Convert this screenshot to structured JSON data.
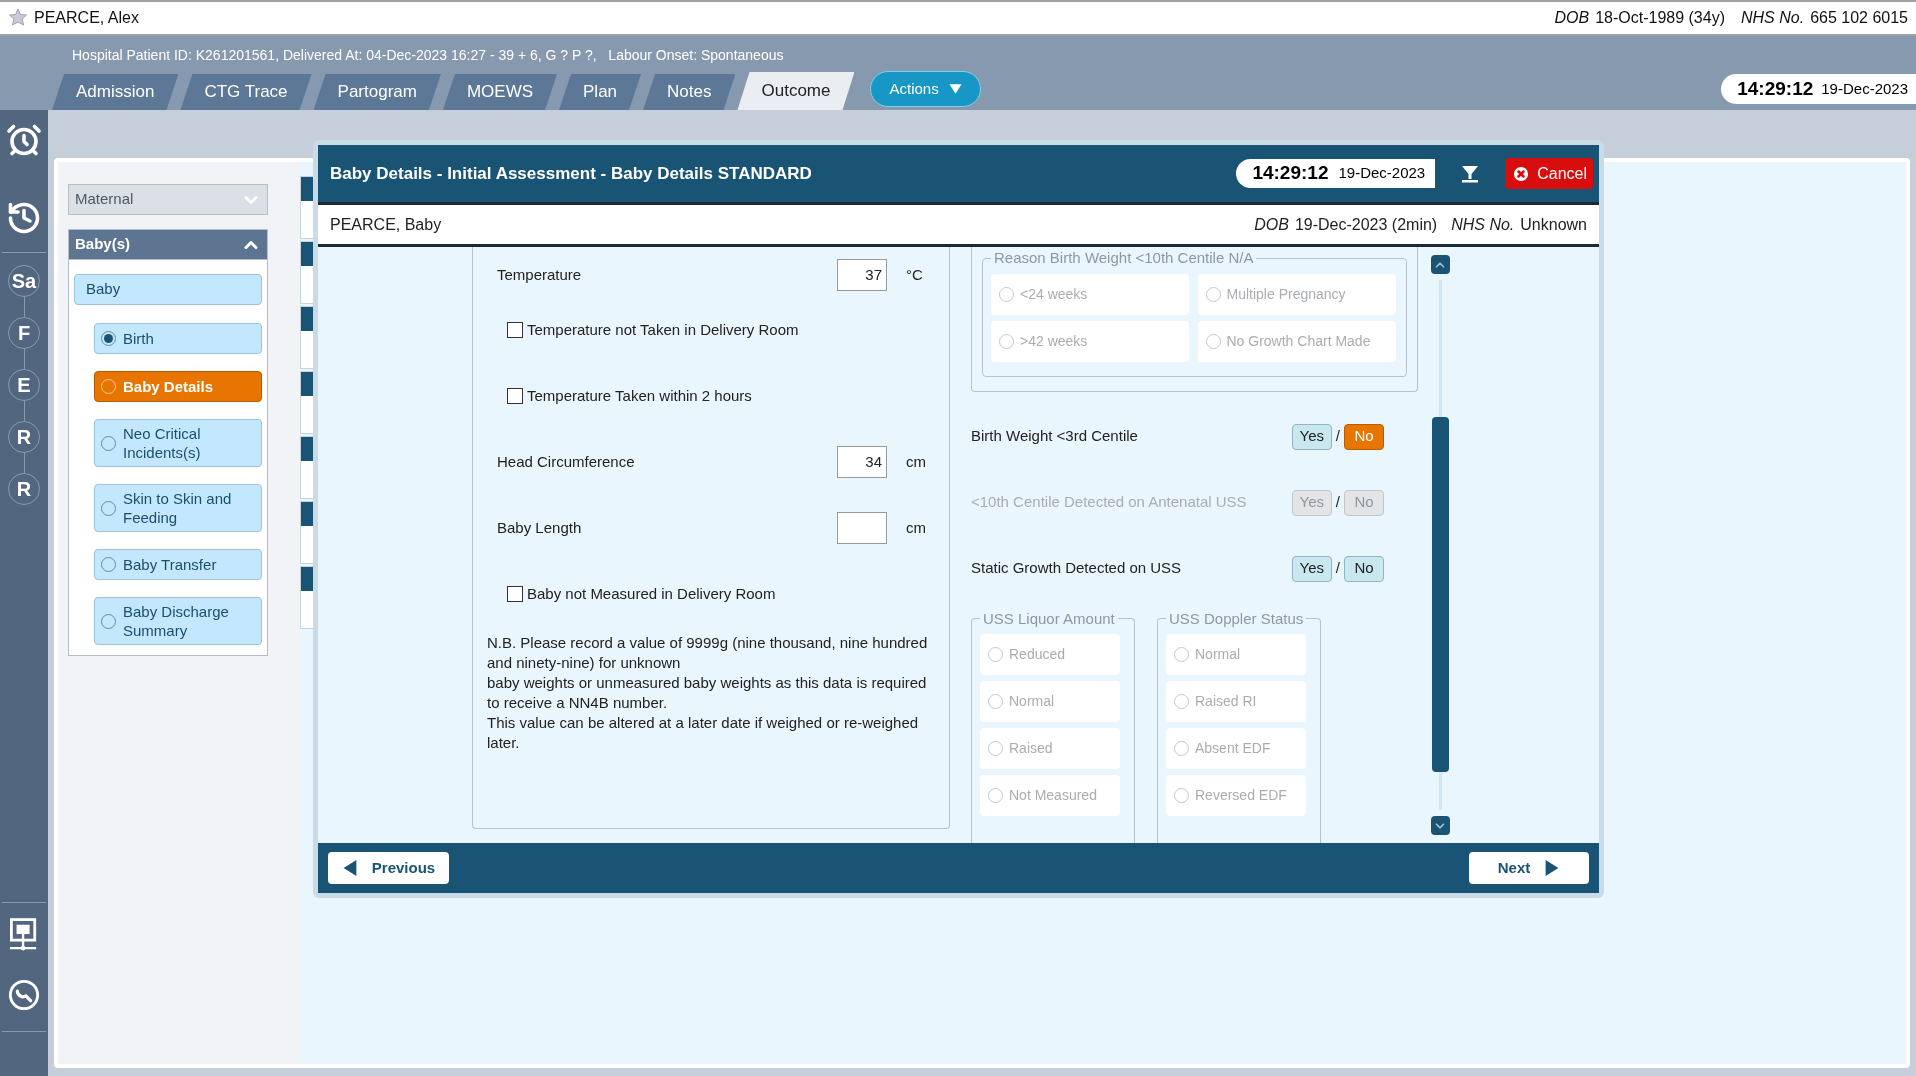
{
  "patient": {
    "name": "PEARCE, Alex",
    "dob_label": "DOB",
    "dob": "18-Oct-1989 (34y)",
    "nhs_label": "NHS No.",
    "nhs": "665 102 6015"
  },
  "banner": "Hospital Patient ID: K261201561, Delivered At: 04-Dec-2023 16:27 - 39 + 6, G ? P ?,   Labour Onset: Spontaneous",
  "tabs": [
    {
      "label": "Admission",
      "selected": false
    },
    {
      "label": "CTG Trace",
      "selected": false
    },
    {
      "label": "Partogram",
      "selected": false
    },
    {
      "label": "MOEWS",
      "selected": false
    },
    {
      "label": "Plan",
      "selected": false
    },
    {
      "label": "Notes",
      "selected": false
    },
    {
      "label": "Outcome",
      "selected": true
    }
  ],
  "actions_button": "Actions",
  "clock": {
    "time": "14:29:12",
    "date": "19-Dec-2023"
  },
  "rail": {
    "steps": [
      "Sa",
      "F",
      "E",
      "R",
      "R"
    ]
  },
  "nav": {
    "sections": [
      {
        "label": "Maternal",
        "expanded": false
      },
      {
        "label": "Baby(s)",
        "expanded": true
      }
    ],
    "group": "Baby",
    "items": [
      {
        "label": "Birth",
        "selected": false,
        "completed": true
      },
      {
        "label": "Baby Details",
        "selected": true,
        "completed": false
      },
      {
        "label": "Neo Critical Incidents(s)",
        "selected": false,
        "completed": false
      },
      {
        "label": "Skin to Skin and Feeding",
        "selected": false,
        "completed": false
      },
      {
        "label": "Baby Transfer",
        "selected": false,
        "completed": false
      },
      {
        "label": "Baby Discharge Summary",
        "selected": false,
        "completed": false
      }
    ]
  },
  "dialog": {
    "title": "Baby Details - Initial Assessment - Baby Details STANDARD",
    "time": "14:29:12",
    "date": "19-Dec-2023",
    "cancel": "Cancel",
    "subject": "PEARCE, Baby",
    "dob_label": "DOB",
    "dob": "19-Dec-2023 (2min)",
    "nhs_label": "NHS No.",
    "nhs": "Unknown",
    "left_fields": [
      {
        "kind": "number",
        "label": "Temperature",
        "value": "37",
        "unit": "°C"
      },
      {
        "kind": "checkbox",
        "label": "Temperature not Taken in Delivery Room",
        "checked": false
      },
      {
        "kind": "checkbox",
        "label": "Temperature Taken within 2 hours",
        "checked": false
      },
      {
        "kind": "number",
        "label": "Head Circumference",
        "value": "34",
        "unit": "cm"
      },
      {
        "kind": "number",
        "label": "Baby Length",
        "unit": "cm"
      },
      {
        "kind": "checkbox",
        "label": "Baby not Measured in Delivery Room",
        "checked": false
      }
    ],
    "note": "N.B. Please record a value of 9999g (nine thousand, nine hundred and ninety-nine) for unknown\nbaby weights or unmeasured baby weights as this data is required to receive a NN4B number.\nThis value can be altered at a later date if weighed or re-weighed later.",
    "reason_group": {
      "legend": "Reason Birth Weight <10th Centile N/A",
      "disabled": true,
      "options": [
        {
          "label": "<24 weeks",
          "selected": false
        },
        {
          "label": "Multiple Pregnancy",
          "selected": false
        },
        {
          "label": ">42 weeks",
          "selected": false
        },
        {
          "label": "No Growth Chart Made",
          "selected": false
        }
      ]
    },
    "yes_no": [
      {
        "label": "Birth Weight <3rd Centile",
        "disabled": false,
        "separator": "/",
        "options": [
          {
            "label": "Yes",
            "selected": false
          },
          {
            "label": "No",
            "selected": true
          }
        ]
      },
      {
        "label": "<10th Centile Detected on Antenatal USS",
        "disabled": true,
        "separator": "/",
        "options": [
          {
            "label": "Yes",
            "selected": false
          },
          {
            "label": "No",
            "selected": false
          }
        ]
      },
      {
        "label": "Static Growth Detected on USS",
        "disabled": false,
        "separator": "/",
        "options": [
          {
            "label": "Yes",
            "selected": false
          },
          {
            "label": "No",
            "selected": false
          }
        ]
      }
    ],
    "uss_groups": [
      {
        "legend": "USS Liquor Amount",
        "disabled": true,
        "options": [
          {
            "label": "Reduced",
            "selected": false
          },
          {
            "label": "Normal",
            "selected": false
          },
          {
            "label": "Raised",
            "selected": false
          },
          {
            "label": "Not Measured",
            "selected": false
          }
        ]
      },
      {
        "legend": "USS Doppler Status",
        "disabled": true,
        "options": [
          {
            "label": "Normal",
            "selected": false
          },
          {
            "label": "Raised RI",
            "selected": false
          },
          {
            "label": "Absent EDF",
            "selected": false
          },
          {
            "label": "Reversed EDF",
            "selected": false
          }
        ]
      }
    ],
    "previous": "Previous",
    "next": "Next"
  }
}
